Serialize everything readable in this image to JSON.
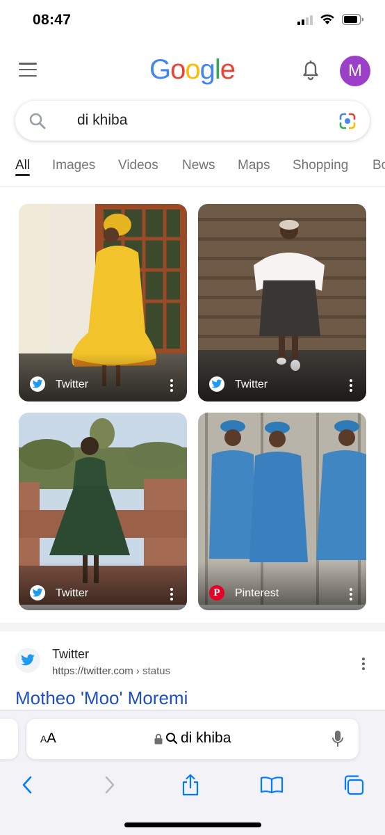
{
  "status_bar": {
    "time": "08:47",
    "icons": [
      "cellular-signal-icon",
      "wifi-icon",
      "battery-icon"
    ]
  },
  "header": {
    "logo_letters": [
      {
        "char": "G",
        "color": "#4285F4"
      },
      {
        "char": "o",
        "color": "#EA4335"
      },
      {
        "char": "o",
        "color": "#FBBC05"
      },
      {
        "char": "g",
        "color": "#4285F4"
      },
      {
        "char": "l",
        "color": "#34A853"
      },
      {
        "char": "e",
        "color": "#EA4335"
      }
    ],
    "avatar_initial": "M",
    "avatar_color": "#9c3fc9"
  },
  "search": {
    "query": "di khiba"
  },
  "tabs": [
    {
      "label": "All",
      "active": true
    },
    {
      "label": "Images",
      "active": false
    },
    {
      "label": "Videos",
      "active": false
    },
    {
      "label": "News",
      "active": false
    },
    {
      "label": "Maps",
      "active": false
    },
    {
      "label": "Shopping",
      "active": false
    },
    {
      "label": "Bo",
      "active": false
    }
  ],
  "image_results": [
    {
      "source": "Twitter",
      "source_icon": "twitter-icon",
      "subject": "yellow dress at doorway"
    },
    {
      "source": "Twitter",
      "source_icon": "twitter-icon",
      "subject": "white top against brick wall"
    },
    {
      "source": "Twitter",
      "source_icon": "twitter-icon",
      "subject": "green dress on balcony"
    },
    {
      "source": "Pinterest",
      "source_icon": "pinterest-icon",
      "subject": "blue dress collage"
    }
  ],
  "web_result": {
    "site_name": "Twitter",
    "url": "https://twitter.com",
    "breadcrumb": "› status",
    "title": "Motheo 'Moo' Moremi"
  },
  "safari": {
    "aa_label": "AA",
    "address_text": "di khiba"
  },
  "colors": {
    "twitter": "#1d9bf0",
    "pinterest": "#e60023",
    "link": "#1f4fc2",
    "safari_blue": "#007aff"
  }
}
